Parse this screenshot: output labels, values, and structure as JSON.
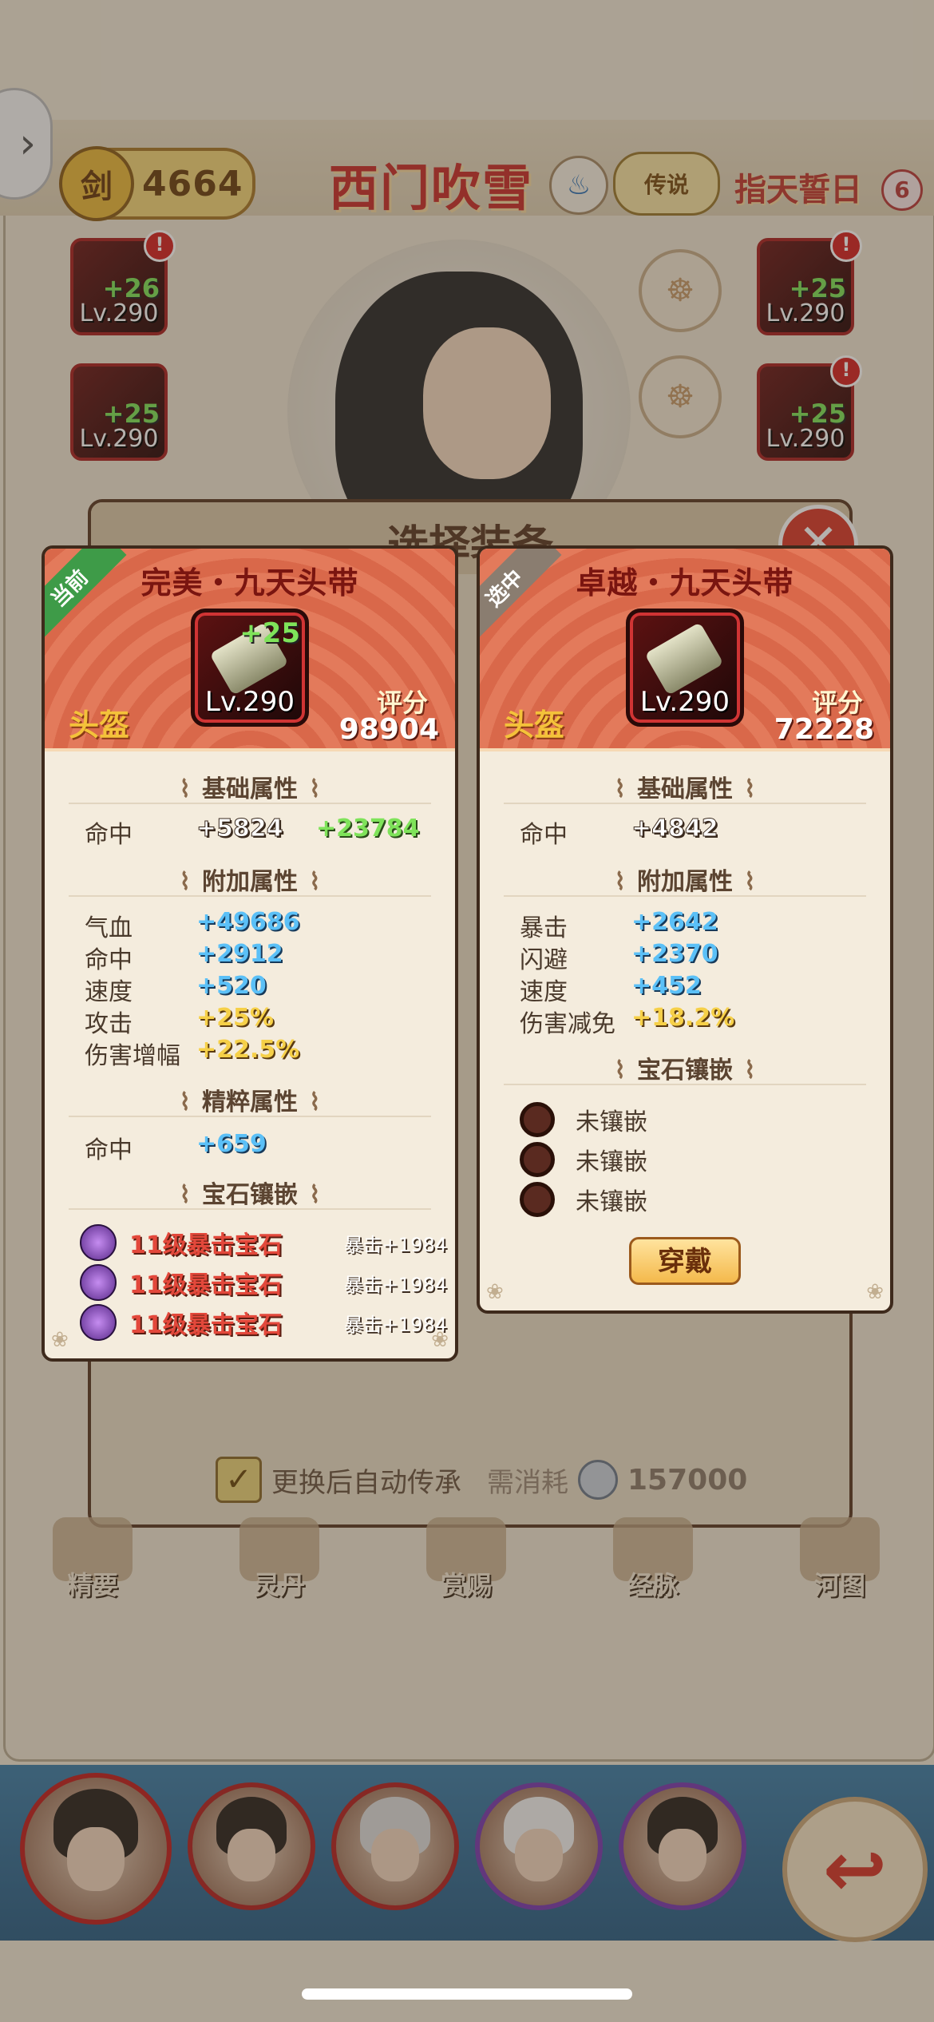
{
  "header": {
    "power_icon": "剑",
    "power": "4664",
    "hero_name": "西门吹雪",
    "legend_badge": "传说",
    "oath": "指天誓日",
    "oath_count": "6"
  },
  "equip_slots": [
    {
      "plus": "+26",
      "level": "Lv.290"
    },
    {
      "plus": "+25",
      "level": "Lv.290"
    },
    {
      "plus": "+25",
      "level": "Lv.290"
    },
    {
      "plus": "+25",
      "level": "Lv.290"
    }
  ],
  "modal": {
    "title": "选择装备",
    "auto_inherit_label": "更换后自动传承",
    "cost_label": "需消耗",
    "cost_value": "157000"
  },
  "nav": [
    "精要",
    "灵丹",
    "赏赐",
    "经脉",
    "河图"
  ],
  "current_card": {
    "ribbon": "当前",
    "title": "完美・九天头带",
    "plus": "+25",
    "level": "Lv.290",
    "slot_type": "头盔",
    "score_label": "评分",
    "score": "98904",
    "base_section": "基础属性",
    "base": [
      {
        "name": "命中",
        "value": "+5824",
        "extra": "+23784"
      }
    ],
    "extra_section": "附加属性",
    "extra": [
      {
        "name": "气血",
        "value": "+49686"
      },
      {
        "name": "命中",
        "value": "+2912"
      },
      {
        "name": "速度",
        "value": "+520"
      },
      {
        "name": "攻击",
        "value": "+25%"
      },
      {
        "name": "伤害增幅",
        "value": "+22.5%"
      }
    ],
    "essence_section": "精粹属性",
    "essence": [
      {
        "name": "命中",
        "value": "+659"
      }
    ],
    "gem_section": "宝石镶嵌",
    "gems": [
      {
        "name": "11级暴击宝石",
        "bonus": "暴击+1984"
      },
      {
        "name": "11级暴击宝石",
        "bonus": "暴击+1984"
      },
      {
        "name": "11级暴击宝石",
        "bonus": "暴击+1984"
      }
    ]
  },
  "selected_card": {
    "ribbon": "选中",
    "title": "卓越・九天头带",
    "level": "Lv.290",
    "slot_type": "头盔",
    "score_label": "评分",
    "score": "72228",
    "base_section": "基础属性",
    "base": [
      {
        "name": "命中",
        "value": "+4842"
      }
    ],
    "extra_section": "附加属性",
    "extra": [
      {
        "name": "暴击",
        "value": "+2642"
      },
      {
        "name": "闪避",
        "value": "+2370"
      },
      {
        "name": "速度",
        "value": "+452"
      },
      {
        "name": "伤害减免",
        "value": "+18.2%"
      }
    ],
    "gem_section": "宝石镶嵌",
    "gem_slots": [
      "未镶嵌",
      "未镶嵌",
      "未镶嵌"
    ],
    "wear_button": "穿戴"
  },
  "colors": {
    "card_header": "#d9684a",
    "title_red": "#7a1510",
    "green_value": "#7fe35a",
    "blue_value": "#5bc0f7",
    "yellow_value": "#f6d048",
    "gem_red": "#e3483b"
  }
}
